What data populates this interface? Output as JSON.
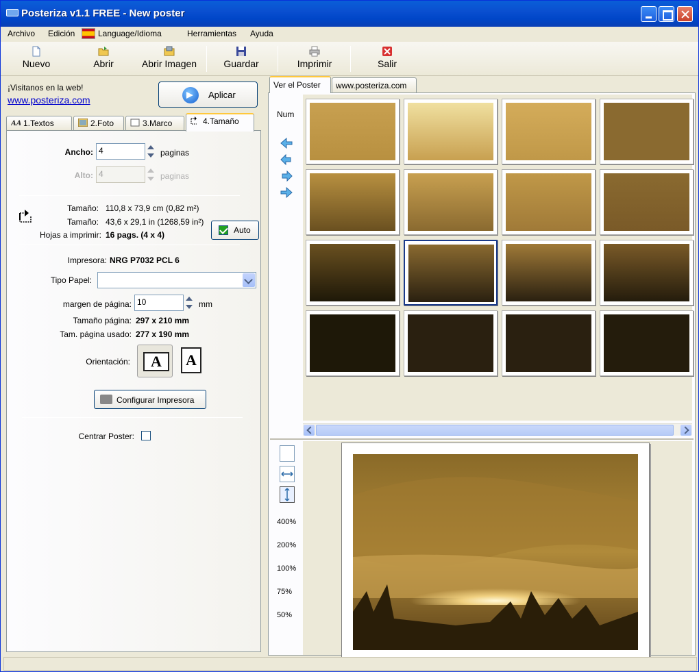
{
  "window": {
    "title": "Posteriza v1.1 FREE - New poster"
  },
  "menu": {
    "items": [
      "Archivo",
      "Edición",
      "Language/Idioma",
      "Herramientas",
      "Ayuda"
    ]
  },
  "toolbar": {
    "nuevo": "Nuevo",
    "abrir": "Abrir",
    "abrir_imagen": "Abrir Imagen",
    "guardar": "Guardar",
    "imprimir": "Imprimir",
    "salir": "Salir"
  },
  "left": {
    "visit": "¡Visitanos en la web!",
    "link": "www.posteriza.com",
    "apply": "Aplicar",
    "tabs": [
      "1.Textos",
      "2.Foto",
      "3.Marco",
      "4.Tamaño"
    ],
    "ancho_label": "Ancho:",
    "ancho_value": "4",
    "paginas1": "paginas",
    "alto_label": "Alto:",
    "alto_value": "4",
    "paginas2": "paginas",
    "auto": "Auto",
    "tam_label1": "Tamaño:",
    "tam_value1": "110,8 x 73,9 cm (0,82 m²)",
    "tam_label2": "Tamaño:",
    "tam_value2": "43,6 x 29,1 in (1268,59 in²)",
    "hojas_label": "Hojas a imprimir:",
    "hojas_value": "16 pags. (4 x 4)",
    "impresora_label": "Impresora:",
    "impresora_value": "NRG P7032 PCL 6",
    "tipo_label": "Tipo Papel:",
    "tipo_value": "",
    "margen_label": "margen de página:",
    "margen_value": "10",
    "margen_unit": "mm",
    "tampag_label": "Tamaño página:",
    "tampag_value": "297 x 210 mm",
    "tamusado_label": "Tam. página usado:",
    "tamusado_value": "277 x 190 mm",
    "orient_label": "Orientación:",
    "orient_glyph": "A",
    "cfg": "Configurar Impresora",
    "centrar": "Centrar Poster:"
  },
  "right": {
    "tabs": [
      "Ver el Poster",
      "www.posteriza.com"
    ],
    "num": "Num",
    "zooms": [
      "400%",
      "200%",
      "100%",
      "75%",
      "50%"
    ],
    "grid": {
      "cols": 4,
      "rows": 4,
      "selected": [
        2,
        1
      ]
    }
  },
  "colors": {
    "xp_blue": "#0a5fd8",
    "accent": "#ffc83c",
    "tile_selected": "#1a3a8a"
  }
}
